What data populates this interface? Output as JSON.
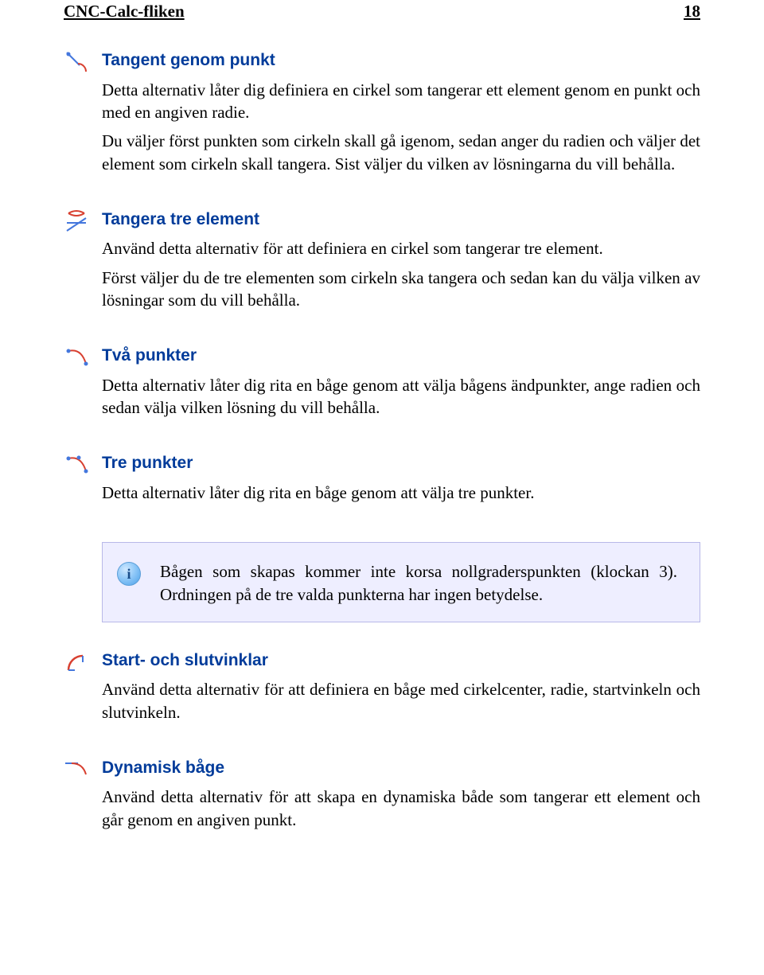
{
  "header": {
    "left": "CNC-Calc-fliken",
    "right": "18"
  },
  "sections": [
    {
      "icon": "tangent-point-icon",
      "title": "Tangent genom punkt",
      "paragraphs": [
        "Detta alternativ låter dig definiera en cirkel som tangerar ett element genom en punkt och med en angiven radie.",
        "Du väljer först punkten som cirkeln skall gå igenom, sedan anger du radien och väljer det element som cirkeln skall tangera. Sist väljer du vilken av lösningarna du vill behålla."
      ]
    },
    {
      "icon": "tangent-three-icon",
      "title": "Tangera tre element",
      "paragraphs": [
        "Använd detta alternativ för att definiera en cirkel som tangerar tre element.",
        "Först väljer du de tre elementen som cirkeln ska tangera och sedan kan du välja vilken av lösningar som du vill behålla."
      ]
    },
    {
      "icon": "two-points-icon",
      "title": "Två punkter",
      "paragraphs": [
        "Detta alternativ låter dig rita en båge genom att välja bågens ändpunkter, ange radien och sedan välja vilken lösning du vill behålla."
      ]
    },
    {
      "icon": "three-points-icon",
      "title": "Tre punkter",
      "paragraphs": [
        "Detta alternativ låter dig rita en båge genom att välja tre punkter."
      ]
    }
  ],
  "infoBox": {
    "text": "Bågen som skapas kommer inte korsa nollgraderspunkten (klockan 3). Ordningen på de tre valda punkterna har ingen betydelse."
  },
  "sectionsAfter": [
    {
      "icon": "start-end-angles-icon",
      "title": "Start- och slutvinklar",
      "paragraphs": [
        "Använd detta alternativ för att definiera en båge med cirkelcenter, radie, startvinkeln och slutvinkeln."
      ]
    },
    {
      "icon": "dynamic-arc-icon",
      "title": "Dynamisk båge",
      "paragraphs": [
        "Använd detta alternativ för att skapa en dynamiska både som tangerar ett element och går genom en angiven punkt."
      ]
    }
  ]
}
